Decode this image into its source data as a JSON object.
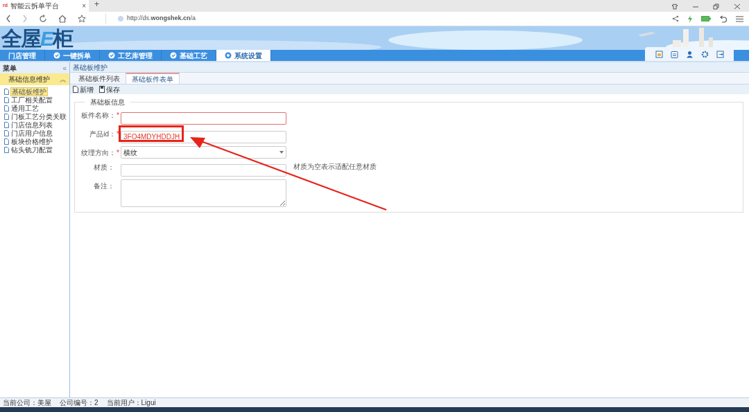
{
  "browser": {
    "tab": {
      "favicon": "rd",
      "title": "智能云拆单平台",
      "close": "×"
    },
    "new_tab": "+",
    "url": "http://ds.**wongshek.cn**/a"
  },
  "header": {
    "logo": [
      {
        "text": "全屋",
        "kind": "plain"
      },
      {
        "text": "E",
        "kind": "accent"
      },
      {
        "text": "柜",
        "kind": "plain"
      }
    ]
  },
  "nav": [
    {
      "label": "门店管理",
      "icon": false,
      "selected": false
    },
    {
      "label": "一键拆单",
      "icon": true,
      "selected": false
    },
    {
      "label": "工艺库管理",
      "icon": true,
      "selected": false
    },
    {
      "label": "基础工艺",
      "icon": true,
      "selected": false
    },
    {
      "label": "系统设置",
      "icon": true,
      "selected": true
    }
  ],
  "sidebar": {
    "title": "菜单",
    "collapse": "«",
    "group": {
      "label": "基础信息维护",
      "toggle": "︽"
    },
    "items": [
      {
        "label": "基础板维护",
        "selected": true
      },
      {
        "label": "工厂相关配置",
        "selected": false
      },
      {
        "label": "通用工艺",
        "selected": false
      },
      {
        "label": "门板工艺分类关联",
        "selected": false
      },
      {
        "label": "门店信息列表",
        "selected": false
      },
      {
        "label": "门店用户信息",
        "selected": false
      },
      {
        "label": "板块价格维护",
        "selected": false
      },
      {
        "label": "钻头铣刀配置",
        "selected": false
      }
    ]
  },
  "breadcrumb": "基础板维护",
  "tabs": [
    {
      "label": "基础板件列表",
      "selected": false
    },
    {
      "label": "基础板件表单",
      "selected": true
    }
  ],
  "toolbar": [
    {
      "label": "新增",
      "kind": "new"
    },
    {
      "label": "保存",
      "kind": "save"
    }
  ],
  "form": {
    "legend": "基础板信息",
    "fields": [
      {
        "label": "板件名称：",
        "required_mark": "*",
        "kind": "text",
        "invalid": true
      },
      {
        "label": "产品id：",
        "required_mark": "*",
        "kind": "text",
        "value": "3FO4MDYHDDJH",
        "annotated": true
      },
      {
        "label": "纹理方向：",
        "required_mark": "*",
        "kind": "select",
        "value": "横纹"
      },
      {
        "label": "材质：",
        "kind": "text",
        "hint": "材质为空表示适配任意材质"
      },
      {
        "label": "备注：",
        "kind": "textarea"
      }
    ]
  },
  "status_bar": [
    "当前公司：美屋",
    "公司编号：2",
    "当前用户：Ligui"
  ]
}
